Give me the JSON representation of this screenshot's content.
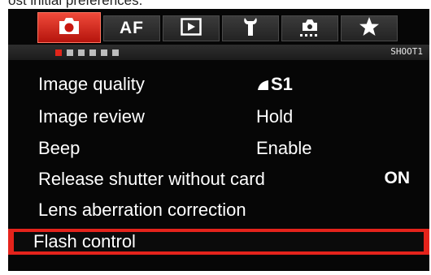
{
  "caption": "ost initial preferences.",
  "camera_menu": {
    "tabs": [
      {
        "icon": "camera-icon",
        "label": "",
        "active": true
      },
      {
        "icon": "af-icon",
        "label": "AF",
        "active": false
      },
      {
        "icon": "playback-icon",
        "label": "",
        "active": false
      },
      {
        "icon": "wrench-icon",
        "label": "",
        "active": false
      },
      {
        "icon": "custom-functions-icon",
        "label": "",
        "active": false
      },
      {
        "icon": "star-icon",
        "label": "",
        "active": false
      }
    ],
    "page_indicator": {
      "count": 6,
      "current": 1,
      "label": "SHOOT1"
    },
    "items": [
      {
        "label": "Image quality",
        "value": "S1",
        "value_icon": "quality-icon"
      },
      {
        "label": "Image review",
        "value": "Hold"
      },
      {
        "label": "Beep",
        "value": "Enable"
      },
      {
        "label": "Release shutter without card",
        "value": "ON"
      },
      {
        "label": "Lens aberration correction",
        "value": ""
      },
      {
        "label": "Flash control",
        "value": "",
        "selected": true
      }
    ],
    "colors": {
      "accent": "#e4231b",
      "background": "#060606",
      "text": "#ffffff"
    }
  }
}
